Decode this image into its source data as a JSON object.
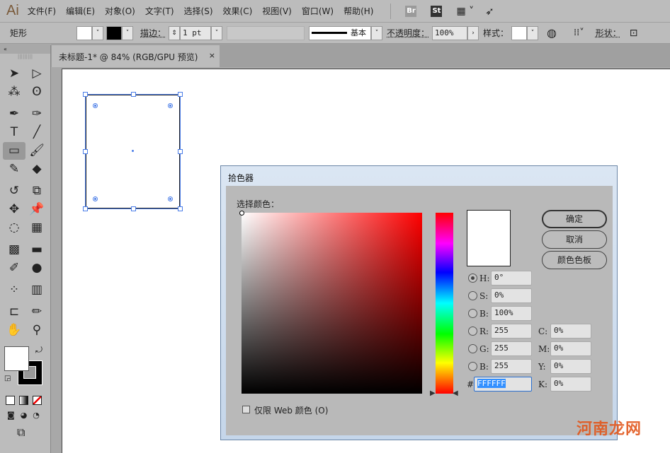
{
  "app": {
    "logo": "Ai"
  },
  "menu": [
    "文件(F)",
    "编辑(E)",
    "对象(O)",
    "文字(T)",
    "选择(S)",
    "效果(C)",
    "视图(V)",
    "窗口(W)",
    "帮助(H)"
  ],
  "app_icons": {
    "bridge": "Br",
    "stock": "St"
  },
  "control": {
    "object_type": "矩形",
    "stroke_label": "描边：",
    "stroke_value": "1 pt",
    "brush_label": "基本",
    "opacity_label": "不透明度：",
    "opacity_value": "100%",
    "style_label": "样式：",
    "shape_label": "形状："
  },
  "document_tab": {
    "title": "未标题-1* @ 84% (RGB/GPU 预览)",
    "close": "×"
  },
  "tools": [
    "selection-icon",
    "direct-selection-icon",
    "magic-wand-icon",
    "lasso-icon",
    "pen-icon",
    "curvature-icon",
    "type-icon",
    "line-icon",
    "rectangle-icon",
    "paintbrush-icon",
    "shaper-icon",
    "eraser-icon",
    "rotate-icon",
    "scale-icon",
    "puppet-warp-icon",
    "pin-icon",
    "shape-builder-icon",
    "perspective-icon",
    "mesh-icon",
    "gradient-icon",
    "eyedropper-icon",
    "blend-icon",
    "symbol-sprayer-icon",
    "graph-icon",
    "artboard-icon",
    "slice-icon",
    "hand-icon",
    "zoom-icon"
  ],
  "dialog": {
    "title": "拾色器",
    "select_label": "选择颜色：",
    "ok": "确定",
    "cancel": "取消",
    "swatches": "颜色色板",
    "fields": {
      "H": "0°",
      "S": "0%",
      "B": "100%",
      "R": "255",
      "G": "255",
      "B2": "255",
      "C": "0%",
      "M": "0%",
      "Y": "0%",
      "K": "0%",
      "hex": "FFFFFF"
    },
    "labels": {
      "H": "H:",
      "S": "S:",
      "B": "B:",
      "R": "R:",
      "G": "G:",
      "B2": "B:",
      "C": "C:",
      "M": "M:",
      "Y": "Y:",
      "K": "K:",
      "hex": "#"
    },
    "selected_mode": "H",
    "web_only": "仅限 Web 颜色 (O)",
    "current_color": "#FFFFFF"
  },
  "watermark": "河南龙网"
}
